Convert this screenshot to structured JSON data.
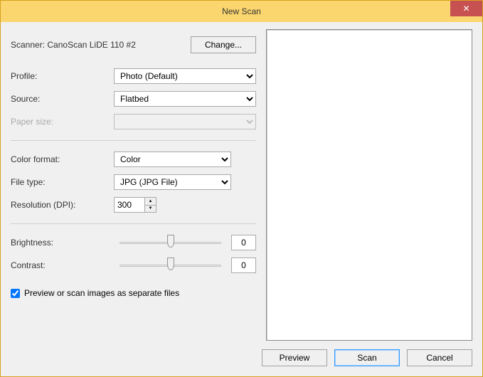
{
  "window": {
    "title": "New Scan"
  },
  "scanner": {
    "label": "Scanner:",
    "value": "CanoScan LiDE 110 #2",
    "change_label": "Change..."
  },
  "profile": {
    "label": "Profile:",
    "value": "Photo (Default)"
  },
  "source": {
    "label": "Source:",
    "value": "Flatbed"
  },
  "paper_size": {
    "label": "Paper size:",
    "value": ""
  },
  "color_format": {
    "label": "Color format:",
    "value": "Color"
  },
  "file_type": {
    "label": "File type:",
    "value": "JPG (JPG File)"
  },
  "resolution": {
    "label": "Resolution (DPI):",
    "value": "300"
  },
  "brightness": {
    "label": "Brightness:",
    "value": "0"
  },
  "contrast": {
    "label": "Contrast:",
    "value": "0"
  },
  "separate_files": {
    "label": "Preview or scan images as separate files",
    "checked": true
  },
  "buttons": {
    "preview": "Preview",
    "scan": "Scan",
    "cancel": "Cancel"
  }
}
